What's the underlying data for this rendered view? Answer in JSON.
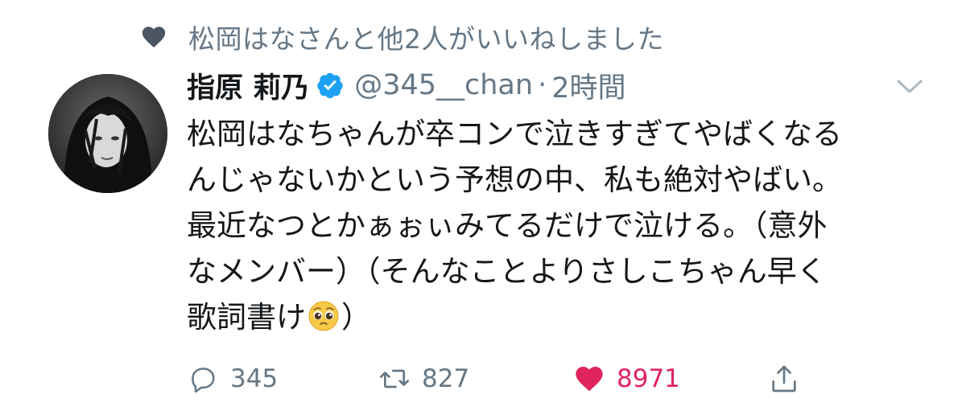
{
  "social_context": {
    "text": "松岡はなさんと他2人がいいねしました",
    "icon": "heart-icon"
  },
  "tweet": {
    "display_name": "指原 莉乃",
    "handle": "@345__chan",
    "separator": "·",
    "time": "2時間",
    "verified": true,
    "text_lines": [
      "松岡はなちゃんが卒コンで泣きすぎてやばくなる",
      "んじゃないかという予想の中、私も絶対やばい。",
      "最近なつとかぁぉぃみてるだけで泣ける。（意外",
      "なメンバー）（そんなことよりさしこちゃん早く"
    ],
    "last_line_before_emoji": "歌詞書け",
    "last_line_after_emoji": "）",
    "emoji": "pleading-face"
  },
  "actions": {
    "reply_count": "345",
    "retweet_count": "827",
    "like_count": "8971"
  },
  "colors": {
    "secondary_text": "#657786",
    "verified_blue": "#1da1f2",
    "like_red": "#e0245e",
    "context_heart": "#4b5563"
  }
}
